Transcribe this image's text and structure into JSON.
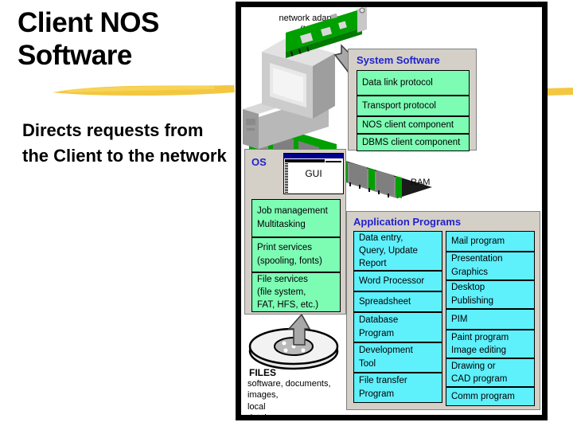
{
  "slide": {
    "title": "Client NOS\nSoftware",
    "subtitle": "Directs requests\nfrom the Client\nto the network",
    "accent_color": "#f2c230",
    "title_color": "#000000"
  },
  "diagram": {
    "border_color": "#000000",
    "background": "#ffffff",
    "labels": {
      "nic": "network adapter\n(NIC)",
      "ram": "RAM",
      "files_heading": "FILES",
      "files_detail": "software, documents,\nimages,\nlocal\ndatabases",
      "gui": "GUI"
    },
    "panels": [
      {
        "id": "system-software",
        "title": "System Software",
        "title_color": "#2222cc",
        "panel_color": "#d4d0c8",
        "box_color": "#7dfcb4",
        "items": [
          "Data link protocol",
          "Transport protocol",
          "NOS client component",
          "DBMS client component"
        ]
      },
      {
        "id": "os",
        "title": "OS",
        "title_color": "#2222cc",
        "panel_color": "#d4d0c8",
        "box_color": "#7dfcb4",
        "items": [
          "Job management\nMultitasking",
          "Print services\n(spooling, fonts)",
          "File services\n(file system,\nFAT, HFS, etc.)"
        ]
      },
      {
        "id": "application-programs",
        "title": "Application Programs",
        "title_color": "#2222cc",
        "panel_color": "#d4d0c8",
        "box_color": "#5ef0fb",
        "column_left": [
          "Data entry,\nQuery, Update\nReport",
          "Word Processor",
          "Spreadsheet",
          "Database\nProgram",
          "Development\nTool",
          "File transfer\nProgram"
        ],
        "column_right": [
          "Mail program",
          "Presentation\nGraphics",
          "Desktop\nPublishing",
          "PIM",
          "Paint program\nImage editing",
          "Drawing or\nCAD program",
          "Comm program"
        ]
      }
    ]
  }
}
